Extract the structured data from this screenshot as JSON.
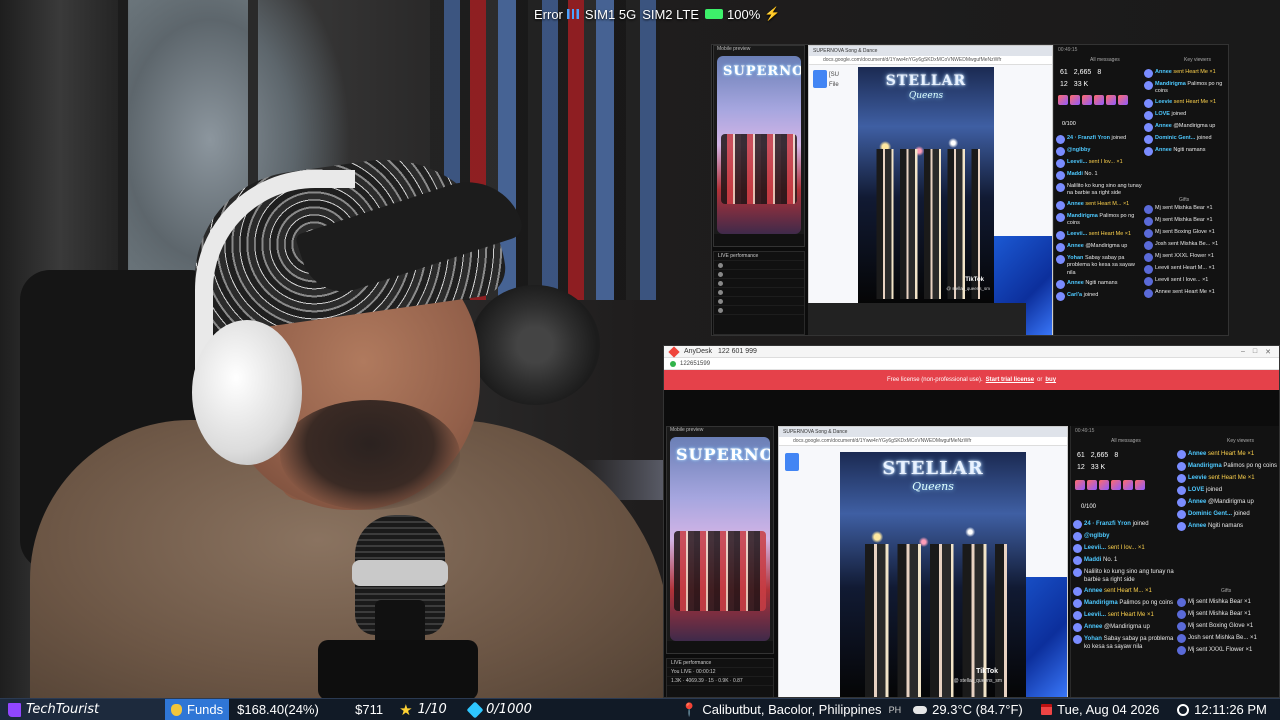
{
  "status_bar": {
    "error_text": "Error",
    "sim1": "SIM1 5G",
    "sim2": "SIM2 LTE",
    "battery": "100%",
    "battery_level": 100
  },
  "monitor_top": {
    "mobile_header": "Mobile preview",
    "mobile_logo": "SUPERNOVA",
    "live_header": "LIVE performance",
    "browser_title": "SUPERNOVA Song & Dance",
    "browser_url": "docs.google.com/document/d/1Yww4nYGy6gSKDxMCoVNWEDMwgufMeNzWfr",
    "doc_letter": "[SU",
    "doc_file": "File",
    "video_title": "STELLAR",
    "video_title2": "Queens",
    "video_brand": "TikTok",
    "video_handle": "@ stellar_queens_sm",
    "chat_clock": "00:49:15",
    "col_all": "All messages",
    "col_key": "Key viewers",
    "stats": [
      "61",
      "2,665",
      "8",
      "12",
      "33 K"
    ],
    "progress": "0/100",
    "left_msgs": [
      {
        "user": "24 · Franzfi Yron",
        "text": "joined"
      },
      {
        "user": "@nglbby",
        "text": ""
      },
      {
        "user": "Leevii...",
        "text": "sent I lov... ×1"
      },
      {
        "user": "Maddi",
        "text": "No. 1"
      },
      {
        "user": "",
        "text": "Nalilito ko kung sino ang tunay na barbie sa right side"
      },
      {
        "user": "Annee",
        "text": "sent Heart M... ×1"
      },
      {
        "user": "Mandirigma",
        "text": "Palimos po ng coins"
      },
      {
        "user": "Leevii...",
        "text": "sent Heart Me ×1"
      },
      {
        "user": "Annee",
        "text": "@Mandirigma up"
      },
      {
        "user": "Yohan",
        "text": "Sabay sabay pa problema ko kesa sa sayaw nila"
      },
      {
        "user": "Annee",
        "text": "Ngiti namans"
      },
      {
        "user": "Carl'a",
        "text": "joined"
      }
    ],
    "right_msgs": [
      {
        "user": "Annee",
        "text": "sent Heart Me ×1"
      },
      {
        "user": "Mandirigma",
        "text": "Palimos po ng coins"
      },
      {
        "user": "Leevie",
        "text": "sent Heart Me ×1"
      },
      {
        "user": "LOVE",
        "text": "joined"
      },
      {
        "user": "Annee",
        "text": "@Mandirigma up"
      },
      {
        "user": "Dominic Gent...",
        "text": "joined"
      },
      {
        "user": "Annee",
        "text": "Ngiti namans"
      }
    ],
    "gifts_header": "Gifts",
    "gift_msgs": [
      "Mj sent Mishka Bear ×1",
      "Mj sent Mishka Bear ×1",
      "Mj sent Boxing Glove ×1",
      "Josh sent Mishka Be... ×1",
      "Mj sent XXXL Flower ×1",
      "Leevii sent Heart M... ×1",
      "Leevii sent I love... ×1",
      "Annee sent Heart Me ×1"
    ]
  },
  "anydesk": {
    "app_name": "AnyDesk",
    "remote_id": "122 601 999",
    "session_id": "122651599",
    "banner_prefix": "Free license (non-professional use).",
    "banner_link1": "Start trial license",
    "banner_mid": "or",
    "banner_link2": "buy",
    "browser_title": "SUPERNOVA Song & Dance",
    "browser_url": "docs.google.com/document/d/1Yww4nYGy6gSKDxMCoVNWEDMwgufMeNzWfr",
    "mobile_header": "Mobile preview",
    "mobile_logo": "SUPERNOVA",
    "live_header": "LIVE performance",
    "live_sub": "You LIVE · 00:00:12",
    "chat_clock": "00:49:15",
    "col_all": "All messages",
    "col_key": "Key viewers",
    "stats": [
      "61",
      "2,665",
      "8",
      "12",
      "33 K"
    ],
    "progress": "0/100",
    "video_title": "STELLAR",
    "video_title2": "Queens",
    "video_brand": "TikTok",
    "video_handle": "@ stellar_queens_sm",
    "live_stats": "1.3K · 4069.39 · 15 · 0.9K · 0.87"
  },
  "ticker": {
    "channel": "TechTourist",
    "funds_label": "Funds",
    "funds_amount": "$168.40(24%)",
    "goal_amount": "$711",
    "stars": "1/10",
    "gems": "0/1000",
    "location": "Calibutbut, Bacolor, Philippines",
    "country_code": "PH",
    "weather": "29.3°C (84.7°F)",
    "date": "Tue, Aug 04 2026",
    "time": "12:11:26 PM"
  },
  "colors": {
    "anydesk_red": "#e5414a",
    "twitch_purple": "#9146ff",
    "funds_blue": "#2f76d6",
    "battery_green": "#3df06a"
  }
}
